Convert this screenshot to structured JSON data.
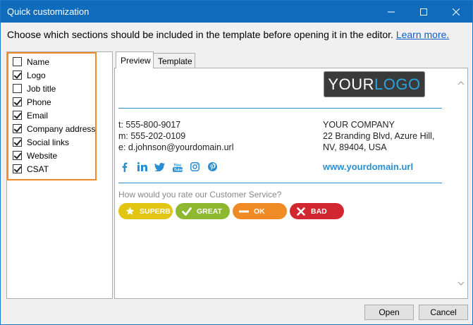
{
  "window": {
    "title": "Quick customization",
    "minimize_icon": "minimize-icon",
    "maximize_icon": "maximize-icon",
    "close_icon": "close-icon"
  },
  "instruction": {
    "text": "Choose which sections should be included in the template before opening it in the editor.",
    "link": "Learn more."
  },
  "options": [
    {
      "label": "Name",
      "checked": false
    },
    {
      "label": "Logo",
      "checked": true
    },
    {
      "label": "Job title",
      "checked": false
    },
    {
      "label": "Phone",
      "checked": true
    },
    {
      "label": "Email",
      "checked": true
    },
    {
      "label": "Company address",
      "checked": true
    },
    {
      "label": "Social links",
      "checked": true
    },
    {
      "label": "Website",
      "checked": true
    },
    {
      "label": "CSAT",
      "checked": true
    }
  ],
  "tabs": [
    {
      "label": "Preview",
      "active": true
    },
    {
      "label": "Template",
      "active": false
    }
  ],
  "preview": {
    "logo_part1": "YOUR",
    "logo_part2": "LOGO",
    "phone": "t: 555-800-9017",
    "mobile": "m: 555-202-0109",
    "email": "e: d.johnson@yourdomain.url",
    "company": "YOUR COMPANY",
    "address1": "22 Branding Blvd, Azure Hill,",
    "address2": "NV, 89404, USA",
    "website": "www.yourdomain.url",
    "social_icons": [
      "facebook-icon",
      "linkedin-icon",
      "twitter-icon",
      "youtube-icon",
      "instagram-icon",
      "pinterest-icon"
    ],
    "csat_question": "How would you rate our Customer Service?",
    "csat": [
      {
        "label": "SUPERB",
        "color": "#e2c412",
        "icon": "star-icon"
      },
      {
        "label": "GREAT",
        "color": "#8db830",
        "icon": "checkmark-icon"
      },
      {
        "label": "OK",
        "color": "#f08a24",
        "icon": "dash-icon"
      },
      {
        "label": "BAD",
        "color": "#d22630",
        "icon": "x-icon"
      }
    ]
  },
  "buttons": {
    "open": "Open",
    "cancel": "Cancel"
  },
  "colors": {
    "titlebar": "#0f6cbd",
    "accent": "#2a8fd0",
    "highlight_border": "#f08a24"
  }
}
